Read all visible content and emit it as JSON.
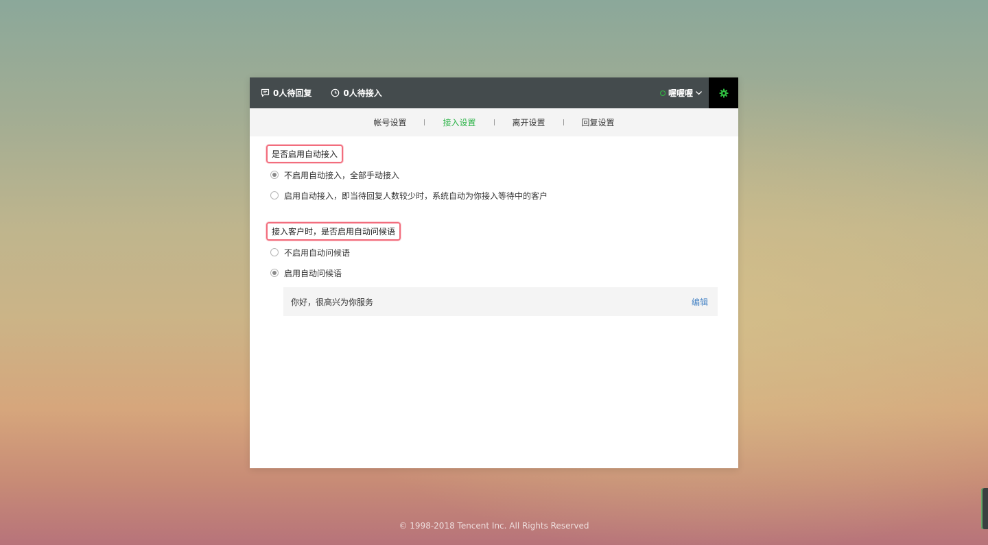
{
  "topbar": {
    "pending_reply": "0人待回复",
    "pending_access": "0人待接入",
    "username": "喔喔喔",
    "icons": {
      "pending_reply": "chat-bubble-icon",
      "pending_access": "clock-icon",
      "settings": "gear-icon",
      "dropdown": "chevron-down-icon"
    },
    "status_color": "#2fbc40"
  },
  "tabs": [
    {
      "label": "帐号设置",
      "active": false
    },
    {
      "label": "接入设置",
      "active": true
    },
    {
      "label": "离开设置",
      "active": false
    },
    {
      "label": "回复设置",
      "active": false
    }
  ],
  "section_auto_access": {
    "title": "是否启用自动接入",
    "options": [
      {
        "label": "不启用自动接入，全部手动接入",
        "checked": true
      },
      {
        "label": "启用自动接入，即当待回复人数较少时，系统自动为你接入等待中的客户",
        "checked": false
      }
    ]
  },
  "section_greeting": {
    "title": "接入客户时，是否启用自动问候语",
    "options": [
      {
        "label": "不启用自动问候语",
        "checked": false
      },
      {
        "label": "启用自动问候语",
        "checked": true
      }
    ],
    "greeting_text": "你好，很高兴为你服务",
    "edit_label": "编辑"
  },
  "footer": {
    "copyright": "© 1998-2018 Tencent Inc. All Rights Reserved"
  },
  "colors": {
    "accent_green": "#2ab246",
    "topbar_bg": "#444b4d",
    "link_blue": "#4a86c6",
    "highlight_red": "#f26d7d"
  }
}
